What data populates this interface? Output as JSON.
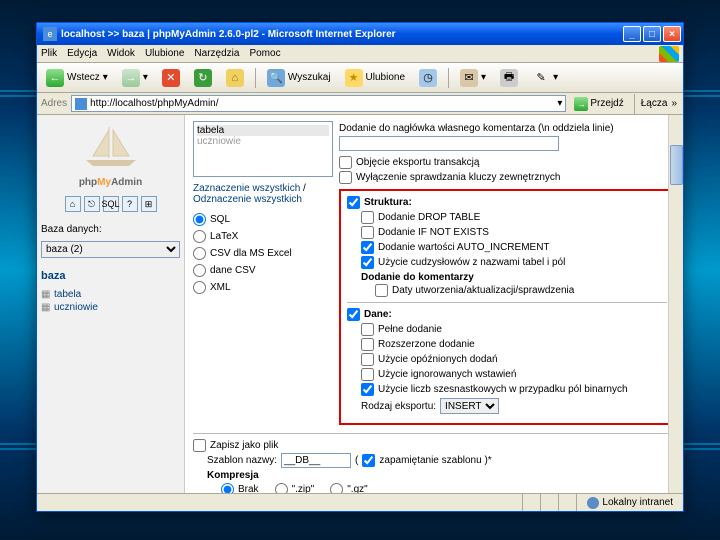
{
  "window": {
    "title": "localhost >> baza | phpMyAdmin 2.6.0-pl2 - Microsoft Internet Explorer"
  },
  "menubar": {
    "file": "Plik",
    "edit": "Edycja",
    "view": "Widok",
    "favorites": "Ulubione",
    "tools": "Narzędzia",
    "help": "Pomoc"
  },
  "toolbar": {
    "back": "Wstecz",
    "search": "Wyszukaj",
    "favorites": "Ulubione"
  },
  "addressbar": {
    "label": "Adres",
    "url": "http://localhost/phpMyAdmin/",
    "go": "Przejdź",
    "links": "Łącza"
  },
  "sidebar": {
    "logo_prefix": "php",
    "logo_my": "My",
    "logo_admin": "Admin",
    "db_label": "Baza danych:",
    "db_select": "baza (2)",
    "db_name": "baza",
    "tables": [
      {
        "name": "tabela"
      },
      {
        "name": "uczniowie"
      }
    ]
  },
  "export": {
    "listbox": {
      "sel": "tabela",
      "other": "uczniowie"
    },
    "select_all": "Zaznaczenie wszystkich",
    "unselect_all": "Odznaczenie wszystkich",
    "formats": {
      "sql": "SQL",
      "latex": "LaTeX",
      "csv_excel": "CSV dla MS Excel",
      "csv": "dane CSV",
      "xml": "XML"
    },
    "header_comment": "Dodanie do nagłówka własnego komentarza (\\n oddziela linie)",
    "transaction": "Objęcie eksportu transakcją",
    "disable_fk": "Wyłączenie sprawdzania kluczy zewnętrznych",
    "structure": {
      "title": "Struktura:",
      "drop": "Dodanie DROP TABLE",
      "notexists": "Dodanie IF NOT EXISTS",
      "autoinc": "Dodanie wartości AUTO_INCREMENT",
      "backquotes": "Użycie cudzysłowów z nazwami tabel i pól",
      "addcomments": "Dodanie do komentarzy",
      "dates": "Daty utworzenia/aktualizacji/sprawdzenia"
    },
    "data": {
      "title": "Dane:",
      "complete": "Pełne dodanie",
      "extended": "Rozszerzone dodanie",
      "delayed": "Użycie opóźnionych dodań",
      "ignore": "Użycie ignorowanych wstawień",
      "hex": "Użycie liczb szesnastkowych w przypadku pól binarnych",
      "export_type": "Rodzaj eksportu:",
      "export_val": "INSERT"
    },
    "saveas": {
      "title": "Zapisz jako plik",
      "template_label": "Szablon nazwy:",
      "template_val": "__DB__",
      "remember": "zapamiętanie szablonu )*",
      "compression": "Kompresja",
      "none": "Brak",
      "zip": "\".zip\"",
      "gz": "\".gz\""
    }
  },
  "statusbar": {
    "zone": "Lokalny intranet"
  }
}
